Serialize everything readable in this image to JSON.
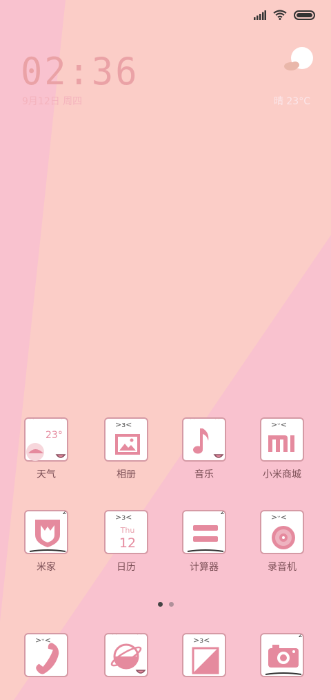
{
  "status_bar": {
    "signal_icon": "cellular-signal-icon",
    "wifi_icon": "wifi-icon",
    "battery_icon": "battery-icon"
  },
  "clock": {
    "time": "02:36",
    "date": "9月12日 周四"
  },
  "weather": {
    "icon": "cloud-sun-icon",
    "text": "晴  23°C"
  },
  "apps": [
    {
      "label": "天气",
      "icon": "weather-app-icon",
      "badge": "23°"
    },
    {
      "label": "相册",
      "icon": "gallery-app-icon"
    },
    {
      "label": "音乐",
      "icon": "music-app-icon"
    },
    {
      "label": "小米商城",
      "icon": "mi-store-app-icon",
      "badge": "MI"
    },
    {
      "label": "米家",
      "icon": "mijia-app-icon"
    },
    {
      "label": "日历",
      "icon": "calendar-app-icon",
      "day_name": "Thu",
      "day_number": "12"
    },
    {
      "label": "计算器",
      "icon": "calculator-app-icon"
    },
    {
      "label": "录音机",
      "icon": "recorder-app-icon"
    }
  ],
  "page_indicator": {
    "total": 2,
    "current": 1
  },
  "dock": [
    {
      "icon": "phone-app-icon"
    },
    {
      "icon": "browser-app-icon"
    },
    {
      "icon": "notes-app-icon"
    },
    {
      "icon": "camera-app-icon"
    }
  ],
  "colors": {
    "background": "#f9c2cf",
    "tile_border": "#d59aa5",
    "accent_pink": "#e58a9e",
    "label_text": "#7a4e55"
  }
}
